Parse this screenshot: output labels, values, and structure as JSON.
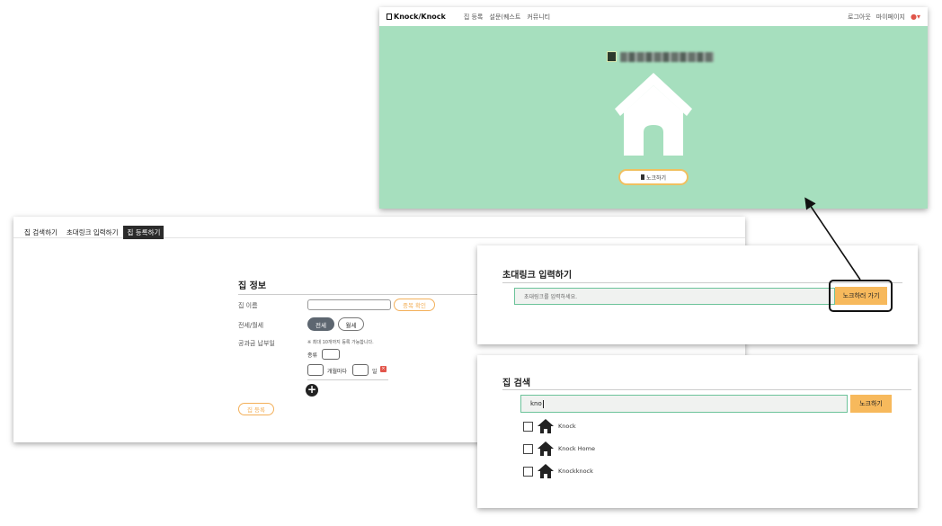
{
  "home": {
    "logo": "Knock/Knock",
    "nav": [
      "집 등록",
      "설문(퀘스트",
      "커뮤니티"
    ],
    "right_links": [
      "로그아웃",
      "마이페이지"
    ],
    "knock_button": "노크하기",
    "colors": {
      "hero_bg": "#a6dfbe",
      "button_border": "#f0c060"
    }
  },
  "register": {
    "tabs": [
      "집 검색하기",
      "초대링크 입력하기",
      "집 등록하기"
    ],
    "active_tab": "집 등록하기",
    "heading": "집 정보",
    "name_label": "집 이름",
    "dup_check": "중복 확인",
    "lease_label": "전세/월세",
    "lease_options": [
      "전세",
      "월세"
    ],
    "utility_label": "공과금 납부일",
    "utility_note": "※ 최대 10개까지 등록 가능합니다.",
    "kind_label": "종류",
    "monthly_label": "개월마다",
    "day_label": "일",
    "submit": "집 등록"
  },
  "invite": {
    "heading": "초대링크 입력하기",
    "placeholder": "초대링크를 입력하세요.",
    "button": "노크하러 가기"
  },
  "search": {
    "heading": "집 검색",
    "query": "kno",
    "button": "노크하기",
    "results": [
      "Knock",
      "Knock Home",
      "Knockknock"
    ]
  }
}
